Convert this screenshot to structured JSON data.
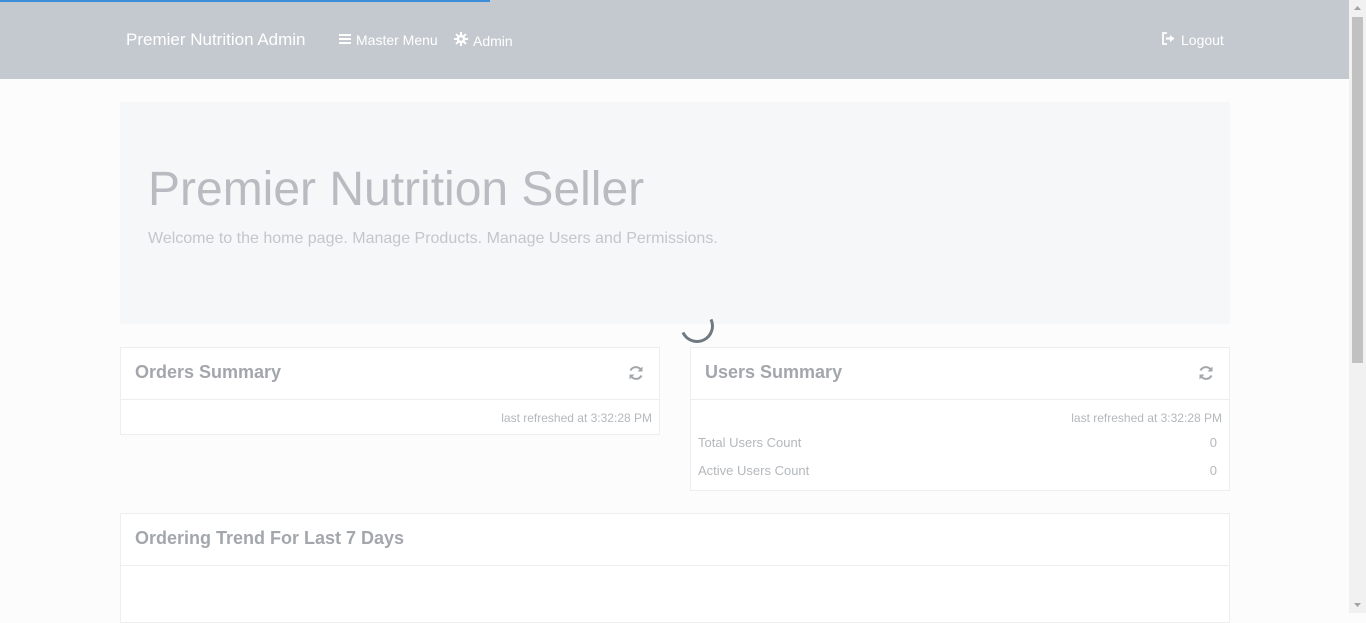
{
  "navbar": {
    "brand": "Premier Nutrition Admin",
    "master_menu": "Master Menu",
    "admin": "Admin",
    "logout": "Logout"
  },
  "jumbotron": {
    "title": "Premier Nutrition Seller",
    "subtitle": "Welcome to the home page. Manage Products. Manage Users and Permissions."
  },
  "orders_summary": {
    "title": "Orders Summary",
    "last_refreshed": "last refreshed at 3:32:28 PM"
  },
  "users_summary": {
    "title": "Users Summary",
    "last_refreshed": "last refreshed at 3:32:28 PM",
    "rows": [
      {
        "label": "Total Users Count",
        "value": "0"
      },
      {
        "label": "Active Users Count",
        "value": "0"
      }
    ]
  },
  "trend": {
    "title": "Ordering Trend For Last 7 Days"
  },
  "colors": {
    "navbar_bg": "#c4c9cf",
    "progress_accent": "#3a8fd8",
    "spinner": "#707880"
  }
}
